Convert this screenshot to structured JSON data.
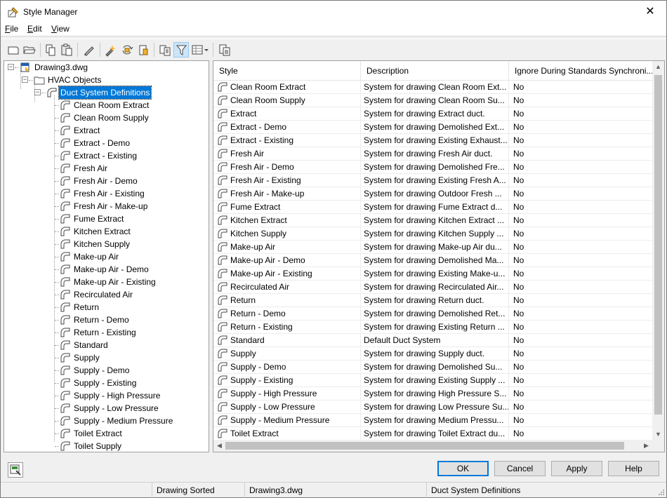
{
  "window": {
    "title": "Style Manager",
    "close_glyph": "✕"
  },
  "menu": [
    {
      "label": "File",
      "accel": "F",
      "rest": "ile"
    },
    {
      "label": "Edit",
      "accel": "E",
      "rest": "dit"
    },
    {
      "label": "View",
      "accel": "V",
      "rest": "iew"
    }
  ],
  "toolbar": {
    "buttons": [
      "new-drawing-icon",
      "open-drawing-icon",
      "copy-icon",
      "paste-icon",
      "edit-style-icon",
      "purge-styles-icon",
      "synchronize-icon",
      "standards-icon",
      "toggle-view-icon",
      "filter-icon",
      "view-mode-icon",
      "inquiry-icon"
    ],
    "active": "filter-icon"
  },
  "tree": {
    "drawing": "Drawing3.dwg",
    "category": "HVAC Objects",
    "definition": "Duct System Definitions",
    "items": [
      "Clean Room Extract",
      "Clean Room Supply",
      "Extract",
      "Extract - Demo",
      "Extract - Existing",
      "Fresh Air",
      "Fresh Air - Demo",
      "Fresh Air - Existing",
      "Fresh Air - Make-up",
      "Fume Extract",
      "Kitchen Extract",
      "Kitchen Supply",
      "Make-up Air",
      "Make-up Air - Demo",
      "Make-up Air - Existing",
      "Recirculated Air",
      "Return",
      "Return - Demo",
      "Return - Existing",
      "Standard",
      "Supply",
      "Supply - Demo",
      "Supply - Existing",
      "Supply - High Pressure",
      "Supply - Low Pressure",
      "Supply - Medium Pressure",
      "Toilet Extract",
      "Toilet Supply"
    ]
  },
  "list": {
    "columns": [
      "Style",
      "Description",
      "Ignore During Standards Synchroni..."
    ],
    "rows": [
      [
        "Clean Room Extract",
        "System for drawing Clean Room Ext...",
        "No"
      ],
      [
        "Clean Room Supply",
        "System for drawing Clean Room Su...",
        "No"
      ],
      [
        "Extract",
        "System for drawing Extract duct.",
        "No"
      ],
      [
        "Extract - Demo",
        "System for drawing Demolished Ext...",
        "No"
      ],
      [
        "Extract - Existing",
        "System for drawing Existing Exhaust...",
        "No"
      ],
      [
        "Fresh Air",
        "System for drawing Fresh Air duct.",
        "No"
      ],
      [
        "Fresh Air - Demo",
        "System for drawing Demolished Fre...",
        "No"
      ],
      [
        "Fresh Air - Existing",
        "System for drawing Existing Fresh A...",
        "No"
      ],
      [
        "Fresh Air - Make-up",
        "System for drawing Outdoor Fresh ...",
        "No"
      ],
      [
        "Fume Extract",
        "System for drawing Fume Extract d...",
        "No"
      ],
      [
        "Kitchen Extract",
        "System for drawing Kitchen Extract ...",
        "No"
      ],
      [
        "Kitchen Supply",
        "System for drawing Kitchen Supply ...",
        "No"
      ],
      [
        "Make-up Air",
        "System for drawing Make-up Air du...",
        "No"
      ],
      [
        "Make-up Air - Demo",
        "System for drawing Demolished Ma...",
        "No"
      ],
      [
        "Make-up Air - Existing",
        "System for drawing Existing Make-u...",
        "No"
      ],
      [
        "Recirculated Air",
        "System for drawing Recirculated Air...",
        "No"
      ],
      [
        "Return",
        "System for drawing Return duct.",
        "No"
      ],
      [
        "Return - Demo",
        "System for drawing Demolished Ret...",
        "No"
      ],
      [
        "Return - Existing",
        "System for drawing Existing Return ...",
        "No"
      ],
      [
        "Standard",
        "Default Duct System",
        "No"
      ],
      [
        "Supply",
        "System for drawing Supply duct.",
        "No"
      ],
      [
        "Supply - Demo",
        "System for drawing Demolished Su...",
        "No"
      ],
      [
        "Supply - Existing",
        "System for drawing Existing Supply ...",
        "No"
      ],
      [
        "Supply - High Pressure",
        "System for drawing High Pressure S...",
        "No"
      ],
      [
        "Supply - Low Pressure",
        "System for drawing Low Pressure Su...",
        "No"
      ],
      [
        "Supply - Medium Pressure",
        "System for drawing Medium Pressu...",
        "No"
      ],
      [
        "Toilet Extract",
        "System for drawing Toilet Extract du...",
        "No"
      ]
    ]
  },
  "buttons": {
    "ok": "OK",
    "cancel": "Cancel",
    "apply": "Apply",
    "help": "Help"
  },
  "status": {
    "sort": "Drawing Sorted",
    "drawing": "Drawing3.dwg",
    "selection": "Duct System Definitions"
  },
  "colors": {
    "selection": "#0078d7",
    "default_button_border": "#0078d7"
  }
}
